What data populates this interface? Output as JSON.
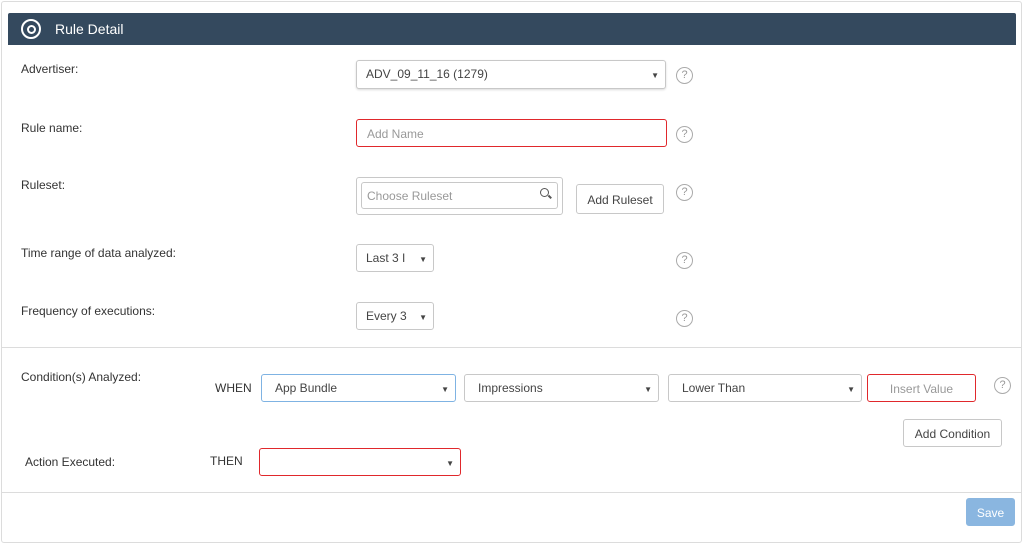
{
  "header": {
    "title": "Rule Detail",
    "icon": "target-icon"
  },
  "form": {
    "advertiser": {
      "label": "Advertiser:",
      "value": "ADV_09_11_16 (1279)"
    },
    "rule_name": {
      "label": "Rule name:",
      "placeholder": "Add Name"
    },
    "ruleset": {
      "label": "Ruleset:",
      "placeholder": "Choose Ruleset",
      "add_button": "Add Ruleset"
    },
    "time_range": {
      "label": "Time range of data analyzed:",
      "value": "Last 3 I"
    },
    "frequency": {
      "label": "Frequency of executions:",
      "value": "Every 3"
    }
  },
  "conditions": {
    "label": "Condition(s) Analyzed:",
    "when": "WHEN",
    "dimension": "App Bundle",
    "metric": "Impressions",
    "operator": "Lower Than",
    "value_placeholder": "Insert Value",
    "add_button": "Add Condition"
  },
  "action": {
    "label": "Action Executed:",
    "then": "THEN",
    "value": ""
  },
  "footer": {
    "save_label": "Save"
  },
  "help_glyph": "?",
  "caret_glyph": "▼",
  "colors": {
    "header_bg": "#34495e",
    "error_border": "#e0282c",
    "save_bg": "#8ab6e0"
  }
}
